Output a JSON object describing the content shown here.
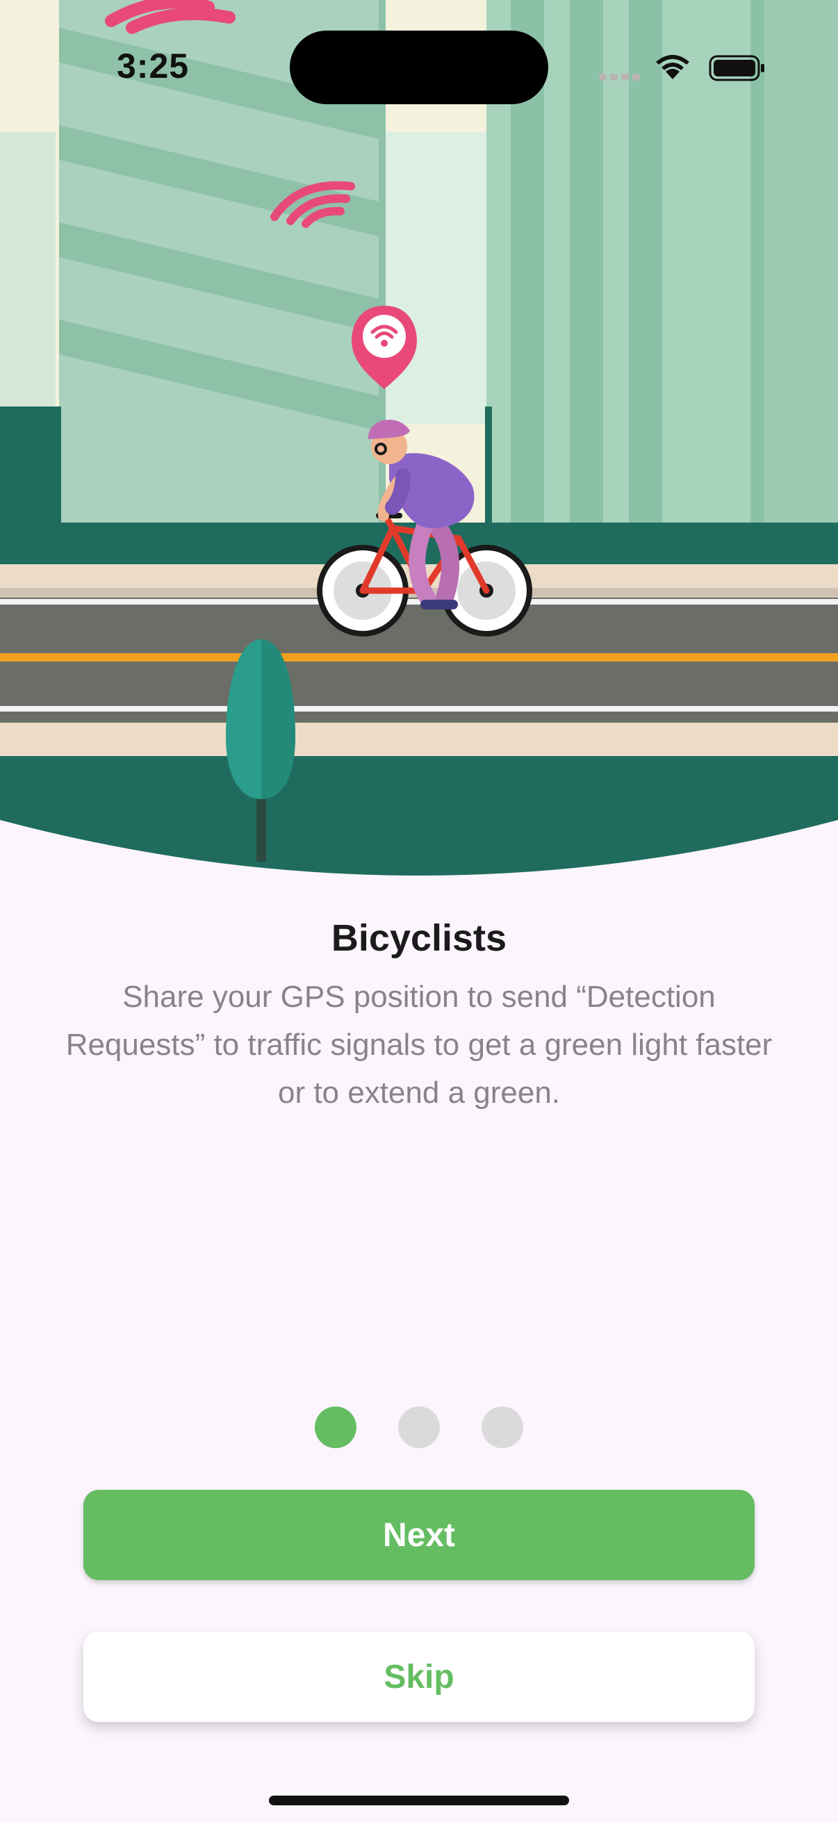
{
  "status_bar": {
    "time": "3:25"
  },
  "onboarding": {
    "title": "Bicyclists",
    "description": "Share your GPS position to send “Detection Requests” to traffic signals to get a green light faster or to extend a green.",
    "page_indicator": {
      "pages": 3,
      "current": 1
    }
  },
  "actions": {
    "next_label": "Next",
    "skip_label": "Skip"
  },
  "colors": {
    "accent": "#65bd62",
    "background": "#fcf5fd",
    "illustration_green": "#1f6c5f",
    "signal_pink": "#e8497a"
  },
  "icons": {
    "status": [
      "cellular-signal-icon",
      "wifi-icon",
      "battery-icon"
    ],
    "illustration": [
      "location-pin-wifi-icon",
      "signal-waves-icon",
      "bicyclist-illustration"
    ]
  }
}
